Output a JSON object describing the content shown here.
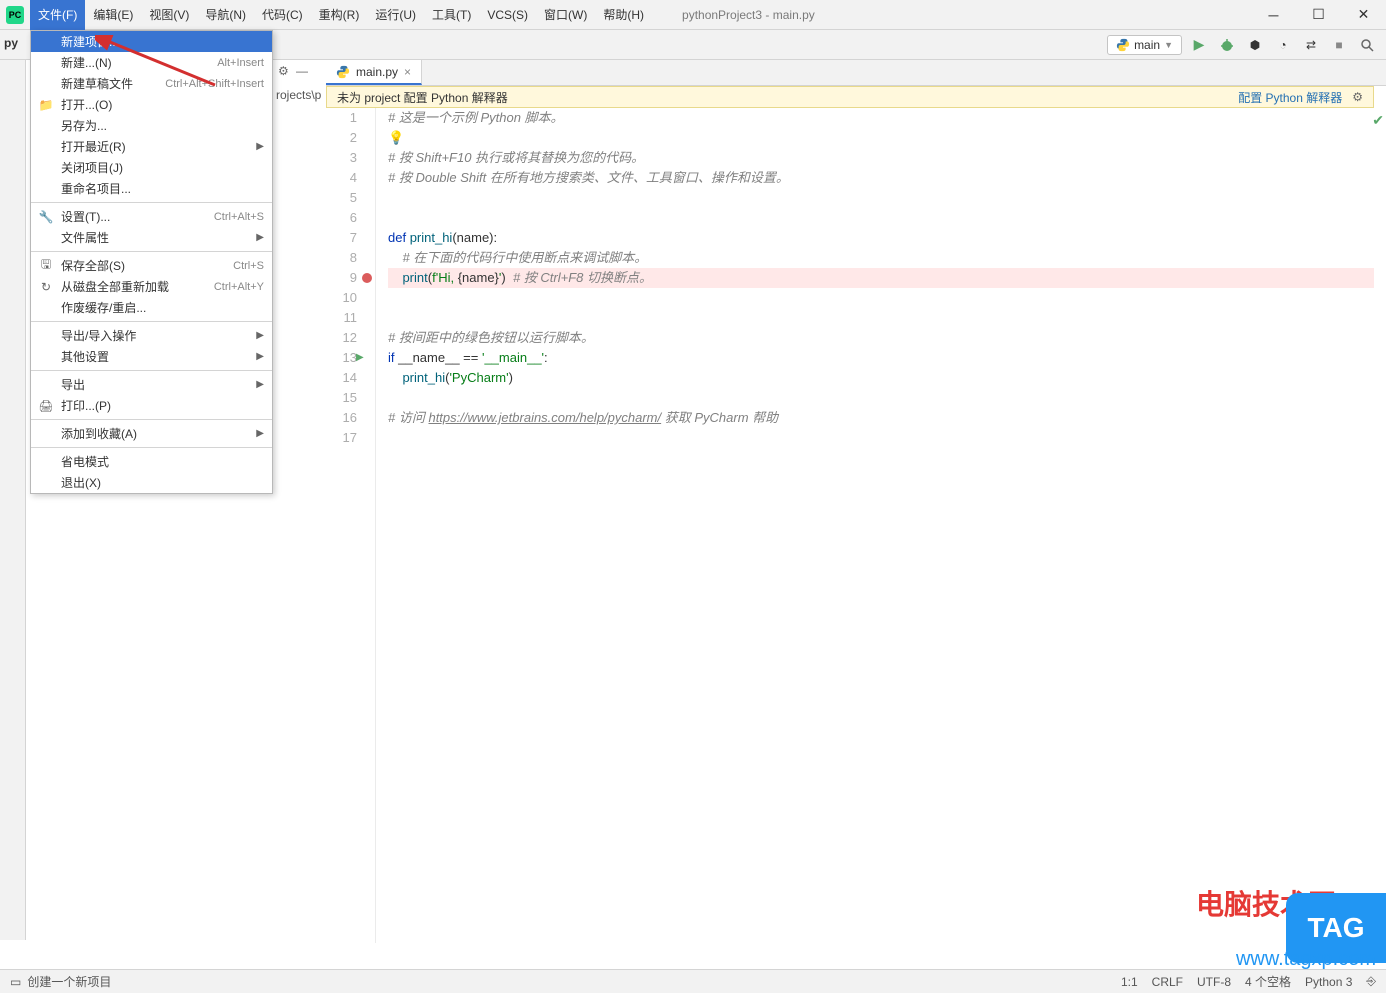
{
  "window": {
    "title": "pythonProject3 - main.py",
    "app_icon": "PC"
  },
  "menubar": [
    "文件(F)",
    "编辑(E)",
    "视图(V)",
    "导航(N)",
    "代码(C)",
    "重构(R)",
    "运行(U)",
    "工具(T)",
    "VCS(S)",
    "窗口(W)",
    "帮助(H)"
  ],
  "file_menu": [
    {
      "label": "新建项目...",
      "highlighted": true
    },
    {
      "label": "新建...(N)",
      "shortcut": "Alt+Insert"
    },
    {
      "label": "新建草稿文件",
      "shortcut": "Ctrl+Alt+Shift+Insert"
    },
    {
      "label": "打开...(O)",
      "icon": "folder"
    },
    {
      "label": "另存为..."
    },
    {
      "label": "打开最近(R)",
      "submenu": true
    },
    {
      "label": "关闭项目(J)"
    },
    {
      "label": "重命名项目..."
    },
    {
      "sep": true
    },
    {
      "label": "设置(T)...",
      "shortcut": "Ctrl+Alt+S",
      "icon": "wrench"
    },
    {
      "label": "文件属性",
      "submenu": true
    },
    {
      "sep": true
    },
    {
      "label": "保存全部(S)",
      "shortcut": "Ctrl+S",
      "icon": "save"
    },
    {
      "label": "从磁盘全部重新加载",
      "shortcut": "Ctrl+Alt+Y",
      "icon": "reload"
    },
    {
      "label": "作废缓存/重启..."
    },
    {
      "sep": true
    },
    {
      "label": "导出/导入操作",
      "submenu": true
    },
    {
      "label": "其他设置",
      "submenu": true
    },
    {
      "sep": true
    },
    {
      "label": "导出",
      "submenu": true
    },
    {
      "label": "打印...(P)",
      "icon": "print"
    },
    {
      "sep": true
    },
    {
      "label": "添加到收藏(A)",
      "submenu": true
    },
    {
      "sep": true
    },
    {
      "label": "省电模式"
    },
    {
      "label": "退出(X)"
    }
  ],
  "toolbar": {
    "run_config": "main",
    "play": "▶"
  },
  "sidebar": {
    "project_label": "py"
  },
  "breadcrumb": {
    "path": "rojects\\p",
    "gear": "⚙",
    "dash": "—"
  },
  "editor_tab": {
    "filename": "main.py"
  },
  "warning": {
    "text": "未为 project 配置 Python 解释器",
    "link": "配置 Python 解释器"
  },
  "code_lines": [
    {
      "n": 1,
      "fold": "⊟",
      "html": "<span class='c-comment'># 这是一个示例 Python 脚本。</span>"
    },
    {
      "n": 2,
      "bulb": true,
      "html": ""
    },
    {
      "n": 3,
      "html": "<span class='c-comment'># 按 Shift+F10 执行或将其替换为您的代码。</span>"
    },
    {
      "n": 4,
      "fold": "⊟",
      "html": "<span class='c-comment'># 按 Double Shift 在所有地方搜索类、文件、工具窗口、操作和设置。</span>"
    },
    {
      "n": 5,
      "html": ""
    },
    {
      "n": 6,
      "html": ""
    },
    {
      "n": 7,
      "fold": "⊟",
      "html": "<span class='c-keyword'>def </span><span class='c-funcname'>print_hi</span>(name):"
    },
    {
      "n": 8,
      "html": "    <span class='c-comment'># 在下面的代码行中使用断点来调试脚本。</span>"
    },
    {
      "n": 9,
      "bp": true,
      "html": "    <span class='c-funcname'>print</span>(<span class='c-fstring'>f'Hi, </span>{name}<span class='c-fstring'>'</span>)  <span class='c-comment'># 按 Ctrl+F8 切换断点。</span>"
    },
    {
      "n": 10,
      "html": ""
    },
    {
      "n": 11,
      "html": ""
    },
    {
      "n": 12,
      "html": "<span class='c-comment'># 按间距中的绿色按钮以运行脚本。</span>"
    },
    {
      "n": 13,
      "fold": "⊟",
      "run": true,
      "html": "<span class='c-keyword'>if</span> __name__ == <span class='c-string'>'__main__'</span>:"
    },
    {
      "n": 14,
      "html": "    <span class='c-funcname'>print_hi</span>(<span class='c-string'>'PyCharm'</span>)"
    },
    {
      "n": 15,
      "html": ""
    },
    {
      "n": 16,
      "html": "<span class='c-comment'># 访问 <span class='c-link'>https://www.jetbrains.com/help/pycharm/</span> 获取 PyCharm 帮助</span>"
    },
    {
      "n": 17,
      "html": ""
    }
  ],
  "statusbar": {
    "hint": "创建一个新项目",
    "right": [
      "1:1",
      "CRLF",
      "UTF-8",
      "4 个空格",
      "Python 3",
      "⎆"
    ]
  },
  "watermarks": {
    "text1": "电脑技术网",
    "tag": "TAG",
    "url": "www.tagxp.com"
  }
}
